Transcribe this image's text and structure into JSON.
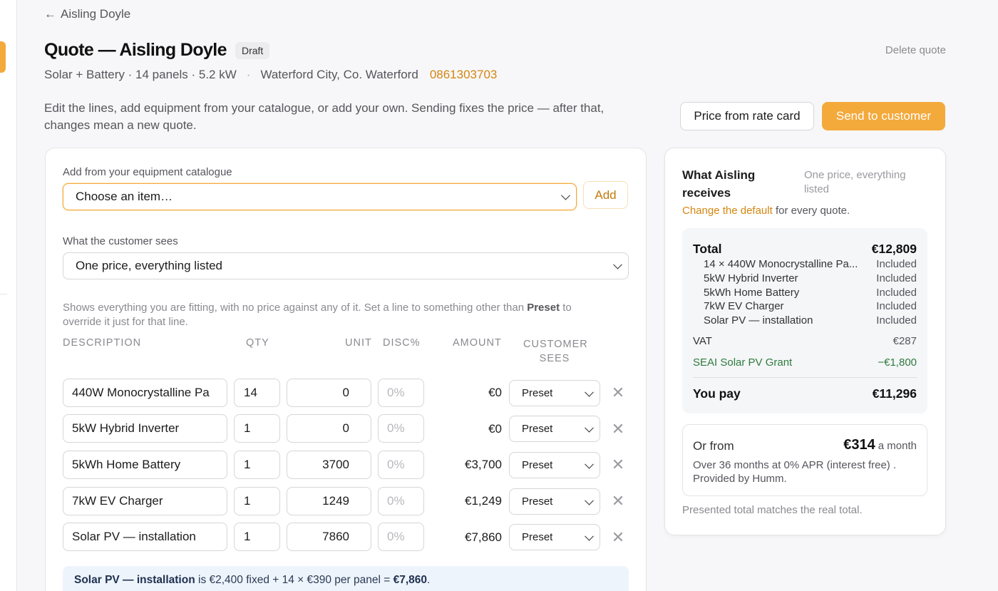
{
  "nav": {
    "back_label": "Aisling Doyle"
  },
  "header": {
    "title": "Quote — Aisling Doyle",
    "status": "Draft",
    "delete_label": "Delete quote",
    "system": "Solar + Battery · 14 panels · 5.2 kW",
    "sep": "·",
    "location": "Waterford City, Co. Waterford",
    "phone": "0861303703",
    "description": "Edit the lines, add equipment from your catalogue, or add your own. Sending fixes the price — after that, changes mean a new quote."
  },
  "actions": {
    "rate_card": "Price from rate card",
    "send": "Send to customer"
  },
  "catalogue": {
    "label": "Add from your equipment catalogue",
    "placeholder": "Choose an item…",
    "add_label": "Add"
  },
  "customer_view": {
    "label": "What the customer sees",
    "selected": "One price, everything listed",
    "hint_pre": "Shows everything you are fitting, with no price against any of it. Set a line to something other than ",
    "hint_bold": "Preset",
    "hint_post": " to override it just for that line."
  },
  "table": {
    "headers": {
      "description": "DESCRIPTION",
      "qty": "QTY",
      "unit": "UNIT",
      "disc": "DISC%",
      "amount": "AMOUNT",
      "sees_1": "CUSTOMER",
      "sees_2": "SEES"
    },
    "rows": [
      {
        "description": "440W Monocrystalline Pa",
        "qty": "14",
        "unit": "0",
        "disc": "0%",
        "amount": "€0",
        "sees": "Preset"
      },
      {
        "description": "5kW Hybrid Inverter",
        "qty": "1",
        "unit": "0",
        "disc": "0%",
        "amount": "€0",
        "sees": "Preset"
      },
      {
        "description": "5kWh Home Battery",
        "qty": "1",
        "unit": "3700",
        "disc": "0%",
        "amount": "€3,700",
        "sees": "Preset"
      },
      {
        "description": "7kW EV Charger",
        "qty": "1",
        "unit": "1249",
        "disc": "0%",
        "amount": "€1,249",
        "sees": "Preset"
      },
      {
        "description": "Solar PV — installation",
        "qty": "1",
        "unit": "7860",
        "disc": "0%",
        "amount": "€7,860",
        "sees": "Preset"
      }
    ],
    "remove_glyph": "✕"
  },
  "info": {
    "item": "Solar PV — installation",
    "text": " is €2,400 fixed + 14 × €390 per panel = ",
    "result": "€7,860",
    "end": "."
  },
  "summary": {
    "title": "What Aisling receives",
    "mode": "One price, everything listed",
    "default_link": "Change the default",
    "default_rest": " for every quote.",
    "total_label": "Total",
    "total_value": "€12,809",
    "items": [
      {
        "name": "14 × 440W Monocrystalline Pa...",
        "value": "Included"
      },
      {
        "name": "5kW Hybrid Inverter",
        "value": "Included"
      },
      {
        "name": "5kWh Home Battery",
        "value": "Included"
      },
      {
        "name": "7kW EV Charger",
        "value": "Included"
      },
      {
        "name": "Solar PV — installation",
        "value": "Included"
      }
    ],
    "vat_label": "VAT",
    "vat_value": "€287",
    "grant_label": "SEAI Solar PV Grant",
    "grant_value": "−€1,800",
    "pay_label": "You pay",
    "pay_value": "€11,296"
  },
  "finance": {
    "label": "Or from",
    "price": "€314",
    "unit": "a month",
    "detail": "Over 36 months at 0% APR (interest free) . Provided by Humm."
  },
  "side_note": "Presented total matches the real total.",
  "colors": {
    "accent": "#f4a93b",
    "link": "#d4860f",
    "grant": "#2f7a3e"
  }
}
